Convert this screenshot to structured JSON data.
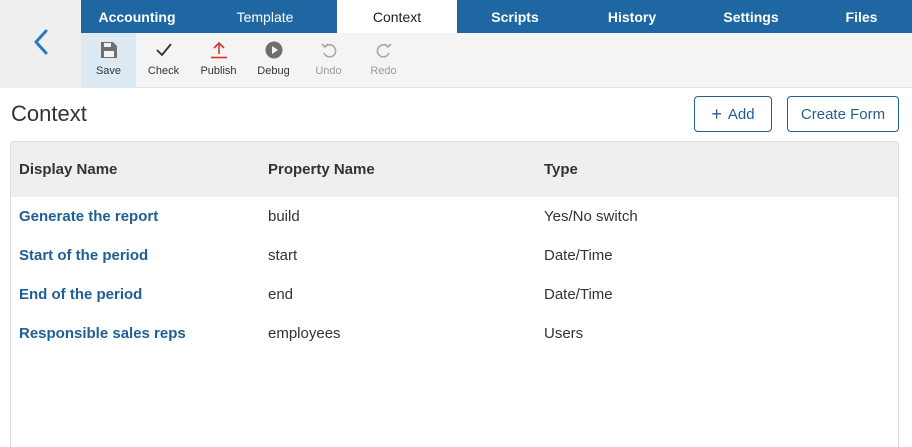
{
  "tabs": [
    {
      "label": "Accounting"
    },
    {
      "label": "Template"
    },
    {
      "label": "Context"
    },
    {
      "label": "Scripts"
    },
    {
      "label": "History"
    },
    {
      "label": "Settings"
    },
    {
      "label": "Files"
    }
  ],
  "active_tab": "Context",
  "toolbar": {
    "save": "Save",
    "check": "Check",
    "publish": "Publish",
    "debug": "Debug",
    "undo": "Undo",
    "redo": "Redo"
  },
  "page": {
    "title": "Context",
    "add_label": "Add",
    "create_form_label": "Create Form"
  },
  "table": {
    "headers": [
      "Display Name",
      "Property Name",
      "Type"
    ],
    "rows": [
      {
        "display_name": "Generate the report",
        "property_name": "build",
        "type": "Yes/No switch"
      },
      {
        "display_name": "Start of the period",
        "property_name": "start",
        "type": "Date/Time"
      },
      {
        "display_name": "End of the period",
        "property_name": "end",
        "type": "Date/Time"
      },
      {
        "display_name": "Responsible sales reps",
        "property_name": "employees",
        "type": "Users"
      }
    ]
  },
  "colors": {
    "tab_bar": "#1f67a3",
    "accent": "#1f5f95",
    "publish_icon": "#d9342b"
  },
  "icons": [
    "chevron-left-icon",
    "floppy-disk-icon",
    "checkmark-icon",
    "upload-arrow-icon",
    "play-circle-icon",
    "undo-icon",
    "redo-icon",
    "plus-icon"
  ]
}
